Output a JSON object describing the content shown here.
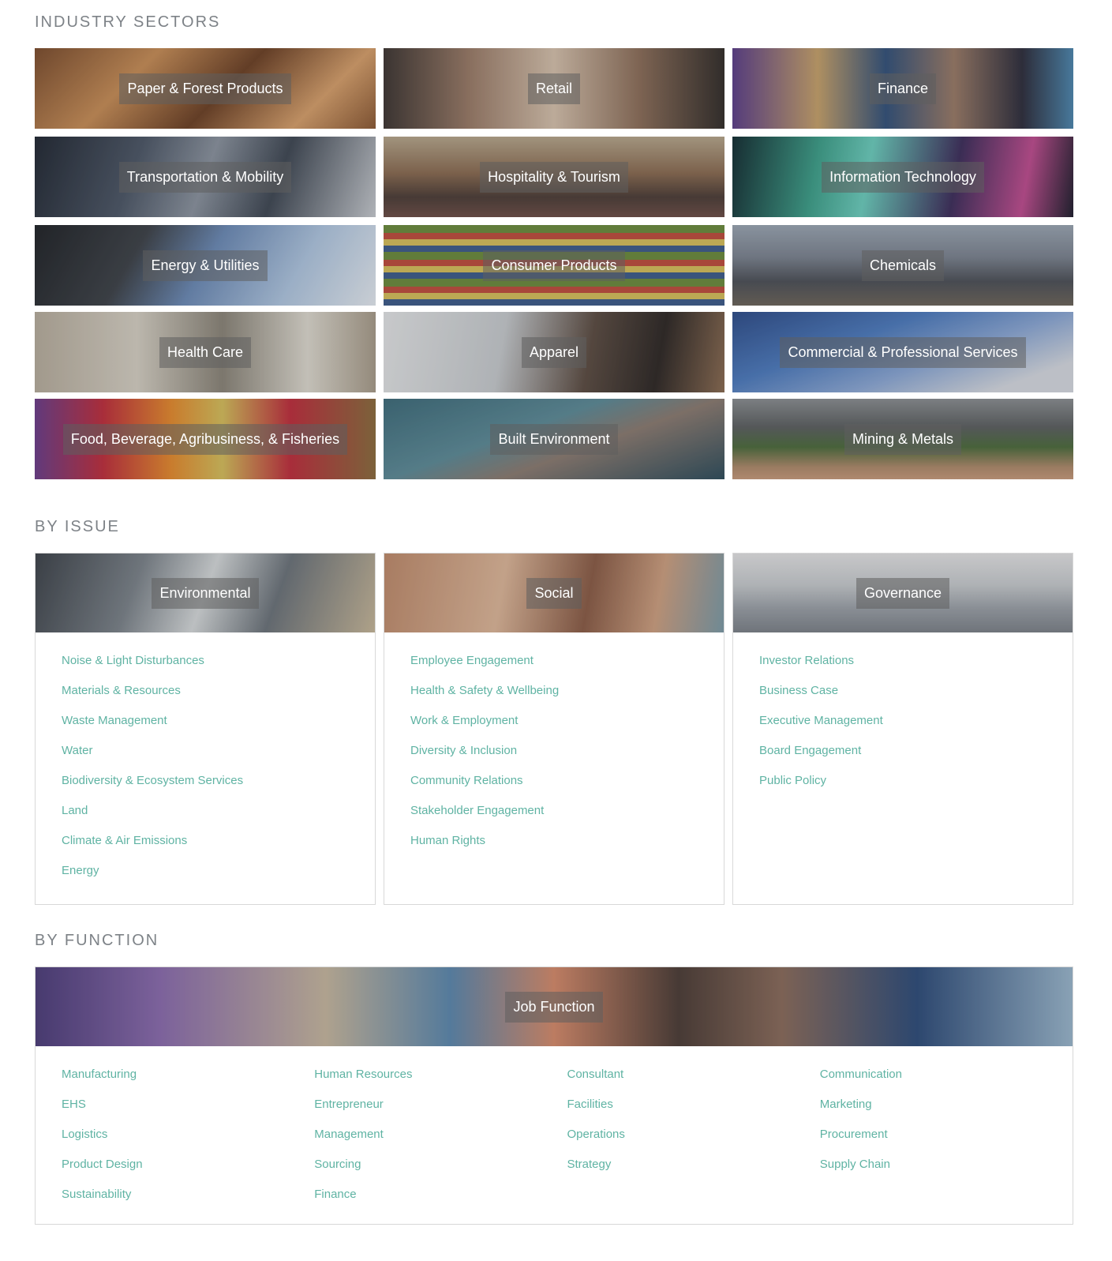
{
  "sections": {
    "industry_sectors": "INDUSTRY SECTORS",
    "by_issue": "BY ISSUE",
    "by_function": "BY FUNCTION"
  },
  "industry_tiles": [
    {
      "label": "Paper & Forest Products"
    },
    {
      "label": "Retail"
    },
    {
      "label": "Finance"
    },
    {
      "label": "Transportation & Mobility"
    },
    {
      "label": "Hospitality & Tourism"
    },
    {
      "label": "Information Technology"
    },
    {
      "label": "Energy & Utilities"
    },
    {
      "label": "Consumer Products"
    },
    {
      "label": "Chemicals"
    },
    {
      "label": "Health Care"
    },
    {
      "label": "Apparel"
    },
    {
      "label": "Commercial & Professional Services"
    },
    {
      "label": "Food, Beverage, Agribusiness, & Fisheries"
    },
    {
      "label": "Built Environment"
    },
    {
      "label": "Mining & Metals"
    }
  ],
  "issues": {
    "environmental": {
      "title": "Environmental",
      "links": [
        "Noise & Light Disturbances",
        "Materials & Resources",
        "Waste Management",
        "Water",
        "Biodiversity & Ecosystem Services",
        "Land",
        "Climate & Air Emissions",
        "Energy"
      ]
    },
    "social": {
      "title": "Social",
      "links": [
        "Employee Engagement",
        "Health & Safety & Wellbeing",
        "Work & Employment",
        "Diversity & Inclusion",
        "Community Relations",
        "Stakeholder Engagement",
        "Human Rights"
      ]
    },
    "governance": {
      "title": "Governance",
      "links": [
        "Investor Relations",
        "Business Case",
        "Executive Management",
        "Board Engagement",
        "Public Policy"
      ]
    }
  },
  "job_function": {
    "title": "Job Function",
    "columns": [
      [
        "Manufacturing",
        "EHS",
        "Logistics",
        "Product Design",
        "Sustainability"
      ],
      [
        "Human Resources",
        "Entrepreneur",
        "Management",
        "Sourcing",
        "Finance"
      ],
      [
        "Consultant",
        "Facilities",
        "Operations",
        "Strategy"
      ],
      [
        "Communication",
        "Marketing",
        "Procurement",
        "Supply Chain"
      ]
    ]
  },
  "colors": {
    "link": "#5fb3a3",
    "section_title": "#7d8287",
    "label_bg": "rgba(95,95,95,0.55)",
    "card_border": "#d8d8d8"
  }
}
